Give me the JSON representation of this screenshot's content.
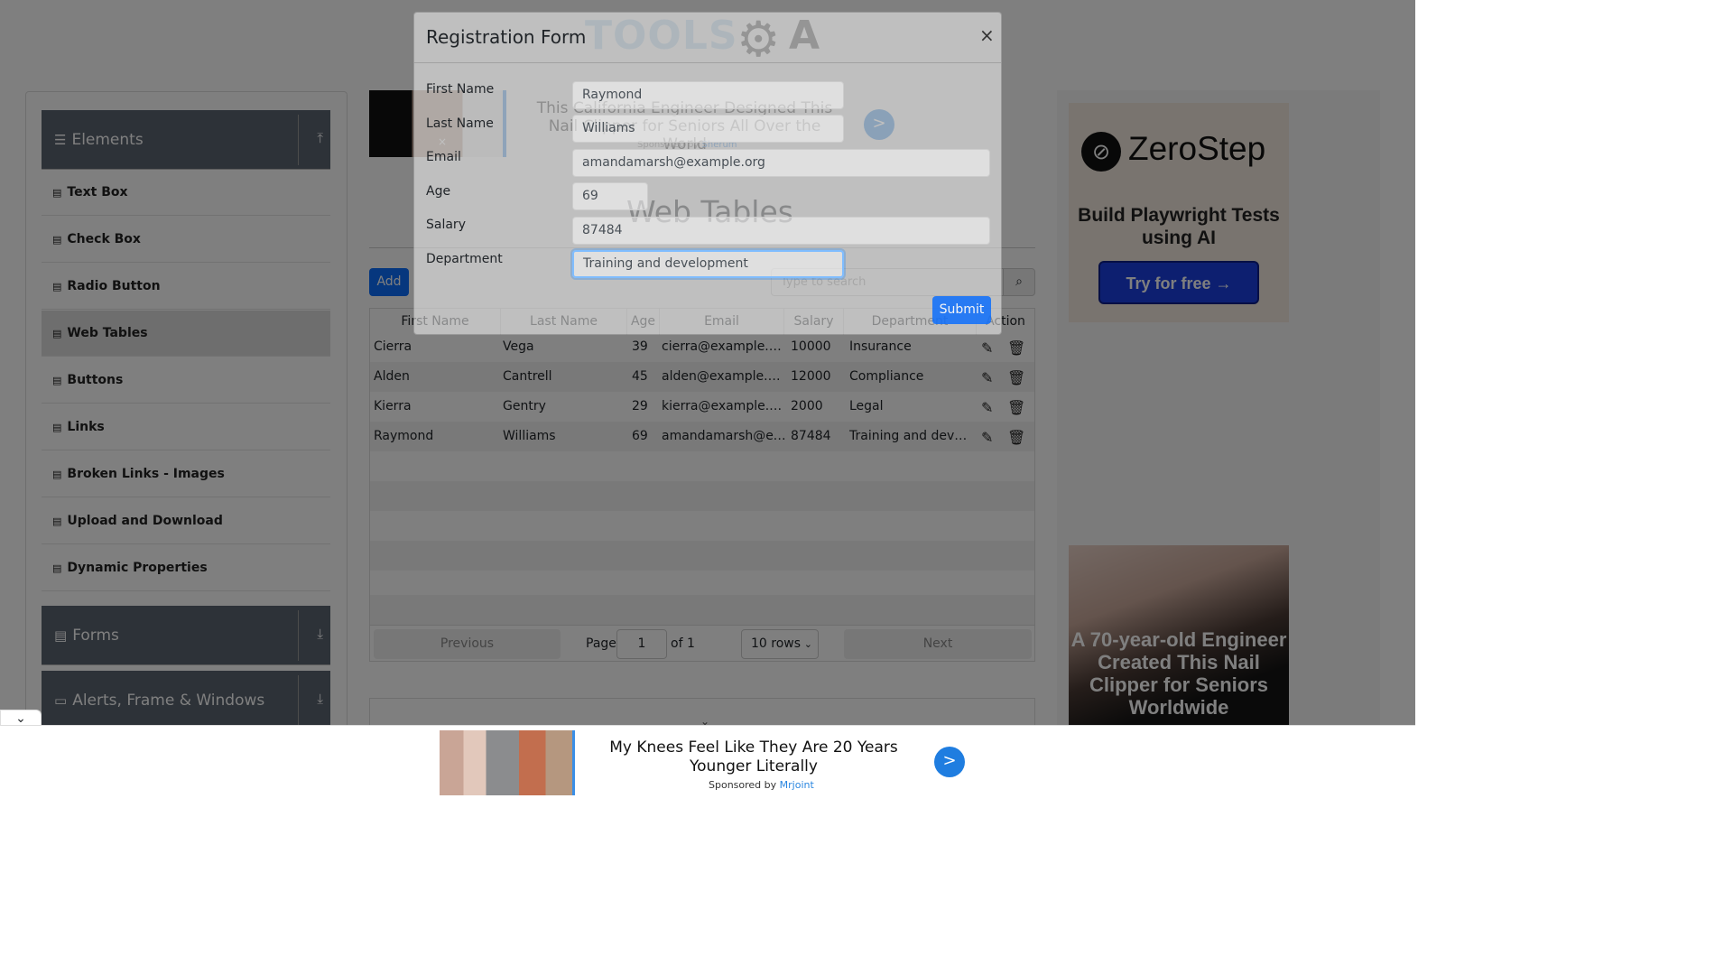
{
  "header": {
    "logo_text": "TOOLS",
    "logo_tail": "A"
  },
  "sidebar": {
    "elements_group": {
      "label": "Elements",
      "icon": "hamburger-icon"
    },
    "items": [
      {
        "label": "Text Box"
      },
      {
        "label": "Check Box"
      },
      {
        "label": "Radio Button"
      },
      {
        "label": "Web Tables",
        "active": true
      },
      {
        "label": "Buttons"
      },
      {
        "label": "Links"
      },
      {
        "label": "Broken Links - Images"
      },
      {
        "label": "Upload and Download"
      },
      {
        "label": "Dynamic Properties"
      }
    ],
    "forms_group": {
      "label": "Forms"
    },
    "alerts_group": {
      "label": "Alerts, Frame & Windows"
    }
  },
  "top_ad": {
    "text": "This California Engineer Designed This Nail Clipper for Seniors All Over the World",
    "sponsor_prefix": "Sponsored by",
    "sponsor_name": "Sherum",
    "button": ">"
  },
  "main": {
    "title": "Web Tables",
    "add_label": "Add",
    "search_placeholder": "Type to search",
    "table": {
      "headers": [
        "First Name",
        "Last Name",
        "Age",
        "Email",
        "Salary",
        "Department",
        "Action"
      ],
      "rows": [
        [
          "Cierra",
          "Vega",
          "39",
          "cierra@example.com",
          "10000",
          "Insurance"
        ],
        [
          "Alden",
          "Cantrell",
          "45",
          "alden@example.com",
          "12000",
          "Compliance"
        ],
        [
          "Kierra",
          "Gentry",
          "29",
          "kierra@example.com",
          "2000",
          "Legal"
        ],
        [
          "Raymond",
          "Williams",
          "69",
          "amandamarsh@example.org",
          "87484",
          "Training and development"
        ]
      ]
    },
    "pagination": {
      "previous": "Previous",
      "page_label": "Page",
      "page_value": "1",
      "of_label": "of 1",
      "rows_select": "10 rows",
      "next": "Next"
    }
  },
  "right_ad": {
    "brand": "ZeroStep",
    "tagline": "Build Playwright Tests using AI",
    "cta": "Try for free →",
    "lower_text": "A 70-year-old Engineer Created This Nail Clipper for Seniors Worldwide"
  },
  "bottom_ad": {
    "text": "My Knees Feel Like They Are 20 Years Younger Literally",
    "sponsor_prefix": "Sponsored by",
    "sponsor_name": "Mrjoint",
    "button": ">"
  },
  "modal": {
    "title": "Registration Form",
    "close": "×",
    "fields": {
      "first_name": {
        "label": "First Name",
        "value": "Raymond"
      },
      "last_name": {
        "label": "Last Name",
        "value": "Williams"
      },
      "email": {
        "label": "Email",
        "value": "amandamarsh@example.org"
      },
      "age": {
        "label": "Age",
        "value": "69"
      },
      "salary": {
        "label": "Salary",
        "value": "87484"
      },
      "department": {
        "label": "Department",
        "value": "Training and development"
      }
    },
    "submit": "Submit"
  }
}
